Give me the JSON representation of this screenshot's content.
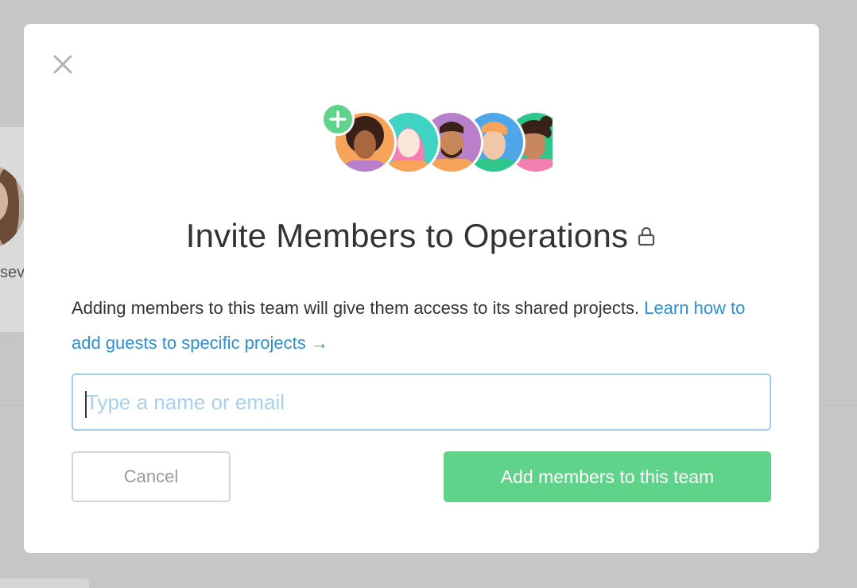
{
  "background": {
    "partial_text": "sev"
  },
  "modal": {
    "close_icon": "close-icon",
    "title": "Invite Members to Operations",
    "title_icon": "lock-icon",
    "description": "Adding members to this team will give them access to its shared projects.",
    "link_text": "Learn how to add guests to specific projects",
    "link_arrow": "→",
    "input_placeholder": "Type a name or email",
    "input_value": "",
    "cancel_label": "Cancel",
    "submit_label": "Add members to this team"
  },
  "colors": {
    "accent_green": "#5fd38a",
    "link_blue": "#2d8fd5",
    "input_border": "#a5cdee",
    "overlay": "#c6c6c6"
  }
}
